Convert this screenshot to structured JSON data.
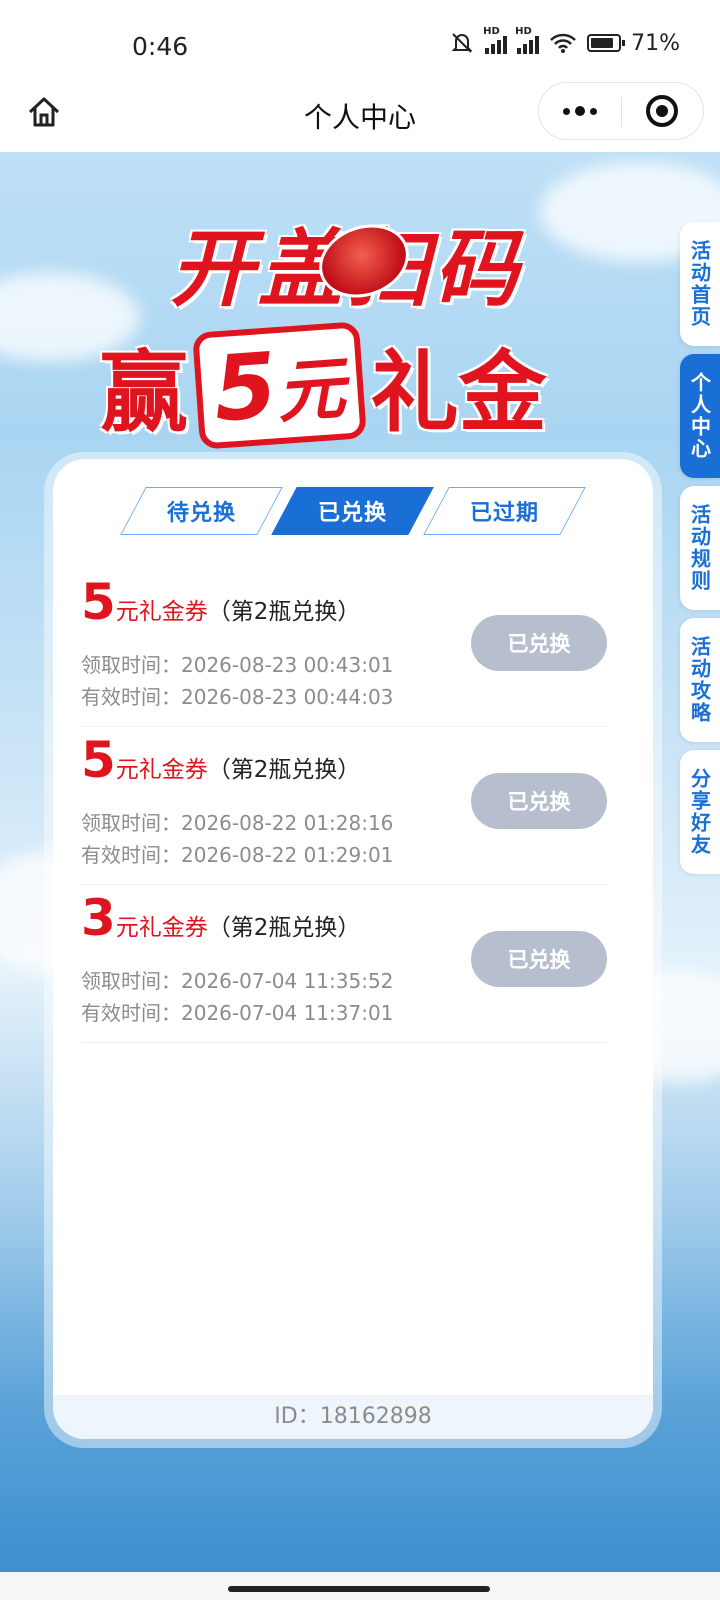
{
  "status_bar": {
    "time": "0:46",
    "battery": "71%"
  },
  "nav": {
    "title": "个人中心"
  },
  "banner": {
    "line1": "开盖扫码",
    "line2_left": "赢",
    "line2_amount": "5",
    "line2_unit": "元",
    "line2_right": "礼金"
  },
  "side_tabs": [
    {
      "label": "活动首页",
      "active": false
    },
    {
      "label": "个人中心",
      "active": true
    },
    {
      "label": "活动规则",
      "active": false
    },
    {
      "label": "活动攻略",
      "active": false
    },
    {
      "label": "分享好友",
      "active": false
    }
  ],
  "tabs": [
    {
      "label": "待兑换",
      "active": false
    },
    {
      "label": "已兑换",
      "active": true
    },
    {
      "label": "已过期",
      "active": false
    }
  ],
  "coupons": [
    {
      "amount": "5",
      "unit": "元礼金券",
      "note": "（第2瓶兑换）",
      "receive": "领取时间：2026-08-23 00:43:01",
      "valid": "有效时间：2026-08-23 00:44:03",
      "button": "已兑换"
    },
    {
      "amount": "5",
      "unit": "元礼金券",
      "note": "（第2瓶兑换）",
      "receive": "领取时间：2026-08-22 01:28:16",
      "valid": "有效时间：2026-08-22 01:29:01",
      "button": "已兑换"
    },
    {
      "amount": "3",
      "unit": "元礼金券",
      "note": "（第2瓶兑换）",
      "receive": "领取时间：2026-07-04 11:35:52",
      "valid": "有效时间：2026-07-04 11:37:01",
      "button": "已兑换"
    }
  ],
  "footer": {
    "id_text": "ID：18162898"
  },
  "colors": {
    "accent_blue": "#1a6fd6",
    "accent_red": "#e0141f",
    "button_disabled": "#b7bfcf"
  }
}
